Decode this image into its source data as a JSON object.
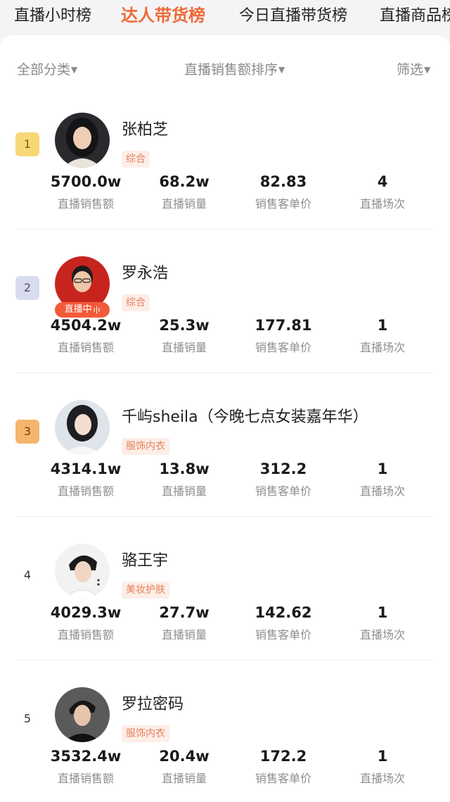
{
  "tabs": [
    {
      "label": "直播小时榜",
      "active": false
    },
    {
      "label": "达人带货榜",
      "active": true
    },
    {
      "label": "今日直播带货榜",
      "active": false
    },
    {
      "label": "直播商品榜",
      "active": false
    }
  ],
  "filters": {
    "category": "全部分类",
    "sort": "直播销售额排序",
    "screen": "筛选"
  },
  "stat_labels": [
    "直播销售额",
    "直播销量",
    "销售客单价",
    "直播场次"
  ],
  "live_badge": "直播中",
  "rankings": [
    {
      "rank": "1",
      "name": "张柏芝",
      "tag": "综合",
      "live": false,
      "stats": [
        "5700.0w",
        "68.2w",
        "82.83",
        "4"
      ]
    },
    {
      "rank": "2",
      "name": "罗永浩",
      "tag": "综合",
      "live": true,
      "stats": [
        "4504.2w",
        "25.3w",
        "177.81",
        "1"
      ]
    },
    {
      "rank": "3",
      "name": "千屿sheila（今晚七点女装嘉年华）",
      "tag": "服饰内衣",
      "live": false,
      "stats": [
        "4314.1w",
        "13.8w",
        "312.2",
        "1"
      ]
    },
    {
      "rank": "4",
      "name": "骆王宇",
      "tag": "美妆护肤",
      "live": false,
      "stats": [
        "4029.3w",
        "27.7w",
        "142.62",
        "1"
      ]
    },
    {
      "rank": "5",
      "name": "罗拉密码",
      "tag": "服饰内衣",
      "live": false,
      "stats": [
        "3532.4w",
        "20.4w",
        "172.2",
        "1"
      ]
    }
  ],
  "colors": {
    "accent": "#f06a36",
    "tag_bg": "#fdeee8",
    "tag_text": "#e7805c",
    "live_badge": "#f25a3a",
    "rank_1": "#f8d776",
    "rank_2": "#d9dcee",
    "rank_3": "#f6b56d"
  }
}
